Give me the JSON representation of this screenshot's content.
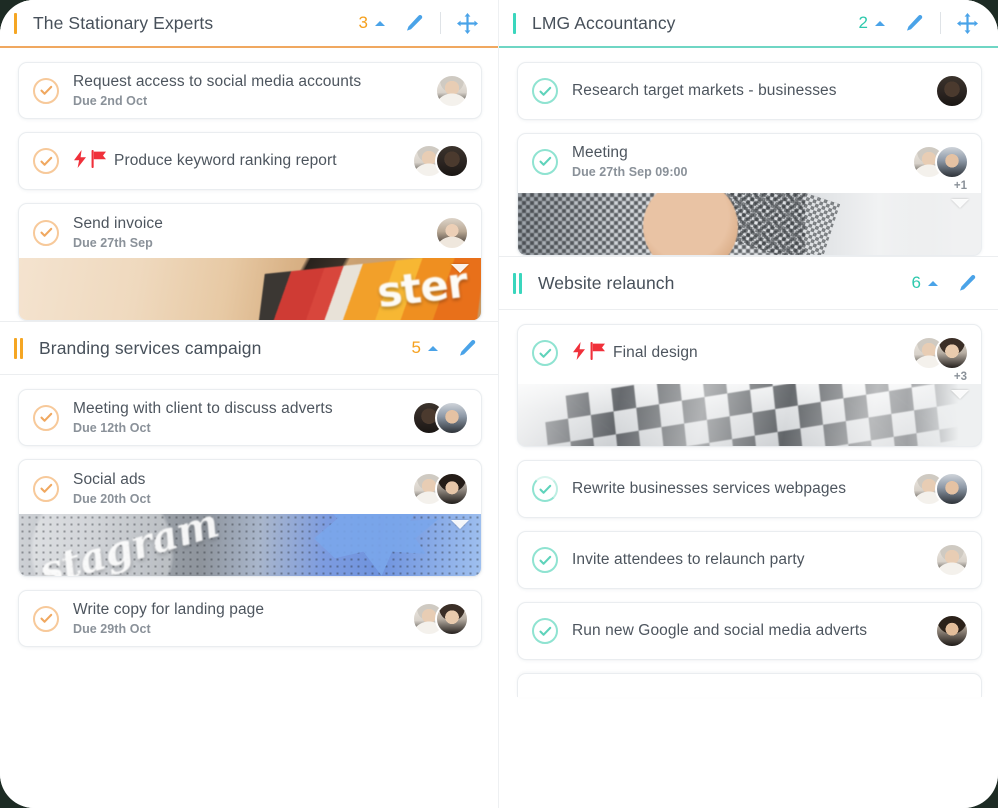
{
  "board": {
    "columns": [
      {
        "id": "left",
        "sections": [
          {
            "name": "the-stationary-experts",
            "title": "The Stationary Experts",
            "count": "3",
            "accent": "#f5a623",
            "count_color": "#f5a01e",
            "type": "primary",
            "bars": 1,
            "has_move": true,
            "collapse_icon": "caret-up-icon",
            "edit_icon": "pencil-icon",
            "move_icon": "move-arrows-icon",
            "cards": [
              {
                "title": "Request access to social media accounts",
                "due": "Due 2nd Oct",
                "check": "orange",
                "flags": [],
                "avatars": [
                  "f1"
                ],
                "more": null,
                "attachment": null
              },
              {
                "title": "Produce keyword ranking report",
                "due": null,
                "check": "orange",
                "flags": [
                  "priority-bolt-icon",
                  "flag-icon"
                ],
                "avatars": [
                  "f1",
                  "f2"
                ],
                "more": null,
                "attachment": null
              },
              {
                "title": "Send invoice",
                "due": "Due 27th Sep",
                "check": "orange",
                "flags": [],
                "avatars": [
                  "f3"
                ],
                "more": null,
                "attachment": "invoice",
                "attachment_word": "ster"
              }
            ]
          },
          {
            "name": "branding-services-campaign",
            "title": "Branding services campaign",
            "count": "5",
            "accent": "#f5a623",
            "count_color": "#f5a01e",
            "type": "sub",
            "bars": 2,
            "has_move": false,
            "collapse_icon": "caret-up-icon",
            "edit_icon": "pencil-icon",
            "cards": [
              {
                "title": "Meeting with client to discuss adverts",
                "due": "Due 12th Oct",
                "check": "orange",
                "flags": [],
                "avatars": [
                  "f2",
                  "f4"
                ],
                "more": null,
                "attachment": null
              },
              {
                "title": "Social ads",
                "due": "Due 20th Oct",
                "check": "orange",
                "flags": [],
                "avatars": [
                  "f1",
                  "f6"
                ],
                "more": null,
                "attachment": "social",
                "attachment_word": "stagram"
              },
              {
                "title": "Write copy for landing page",
                "due": "Due 29th Oct",
                "check": "orange",
                "flags": [],
                "avatars": [
                  "f1",
                  "f5"
                ],
                "more": null,
                "attachment": null
              }
            ]
          }
        ]
      },
      {
        "id": "right",
        "sections": [
          {
            "name": "lmg-accountancy",
            "title": "LMG Accountancy",
            "count": "2",
            "accent": "#3ad6bd",
            "count_color": "#2ec9ad",
            "type": "primary-teal",
            "bars": 1,
            "has_move": true,
            "collapse_icon": "caret-up-icon",
            "edit_icon": "pencil-icon",
            "move_icon": "move-arrows-icon",
            "cards": [
              {
                "title": "Research target markets - businesses",
                "due": null,
                "check": "teal",
                "flags": [],
                "avatars": [
                  "f2"
                ],
                "more": null,
                "attachment": null
              },
              {
                "title": "Meeting",
                "due": "Due 27th Sep 09:00",
                "check": "teal",
                "flags": [],
                "avatars": [
                  "f1",
                  "f4"
                ],
                "more": "+1",
                "attachment": "meeting"
              }
            ]
          },
          {
            "name": "website-relaunch",
            "title": "Website relaunch",
            "count": "6",
            "accent": "#3ad6bd",
            "count_color": "#2ec9ad",
            "type": "sub",
            "bars": 2,
            "has_move": false,
            "collapse_icon": "caret-up-icon",
            "edit_icon": "pencil-icon",
            "cards": [
              {
                "title": "Final design",
                "due": null,
                "check": "teal",
                "flags": [
                  "priority-bolt-icon",
                  "flag-icon"
                ],
                "avatars": [
                  "f1",
                  "f5"
                ],
                "more": "+3",
                "attachment": "flag"
              },
              {
                "title": "Rewrite businesses services webpages",
                "due": null,
                "check": "teal-partial",
                "flags": [],
                "avatars": [
                  "f1",
                  "f4"
                ],
                "more": null,
                "attachment": null
              },
              {
                "title": "Invite attendees to relaunch party",
                "due": null,
                "check": "teal",
                "flags": [],
                "avatars": [
                  "f1"
                ],
                "more": null,
                "attachment": null
              },
              {
                "title": "Run new Google and social media adverts",
                "due": null,
                "check": "teal",
                "flags": [],
                "avatars": [
                  "f7"
                ],
                "more": null,
                "attachment": null
              }
            ],
            "has_peek_card": true
          }
        ]
      }
    ]
  }
}
